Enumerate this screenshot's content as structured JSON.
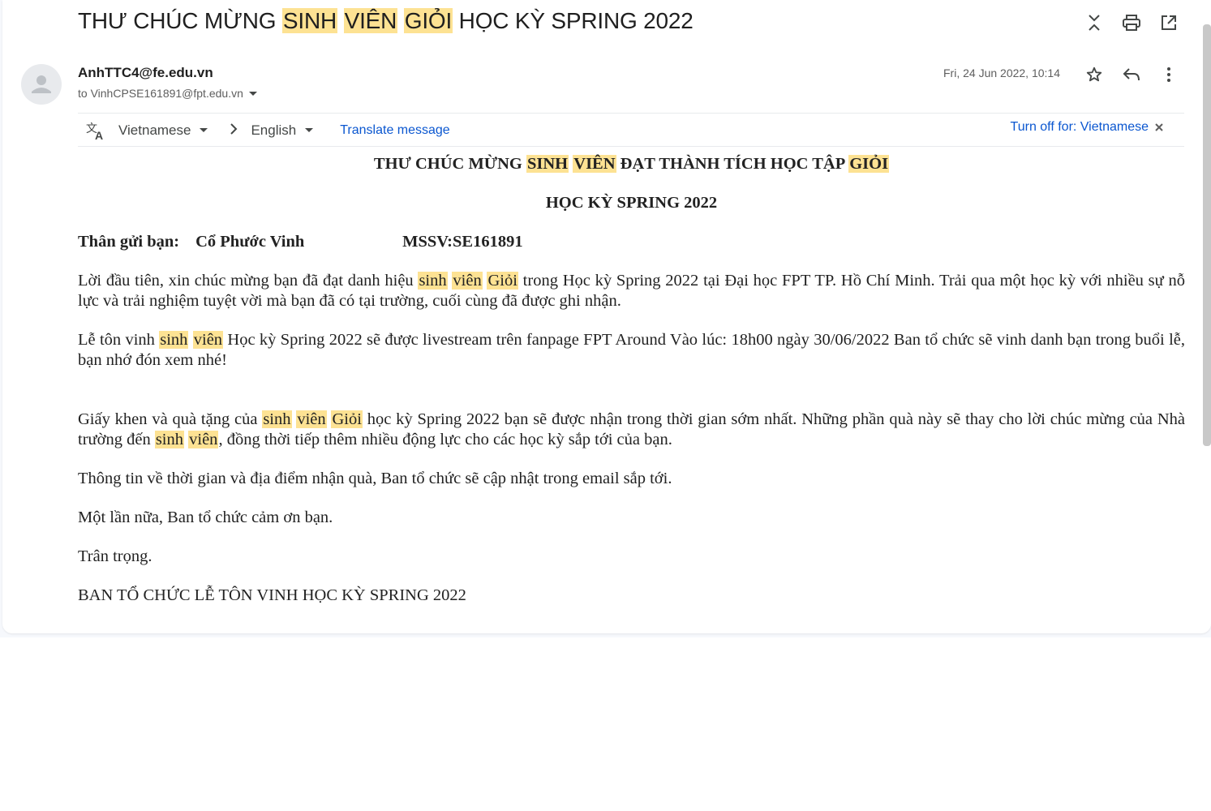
{
  "email": {
    "subject_parts": [
      {
        "text": "THƯ CHÚC MỪNG ",
        "hl": false
      },
      {
        "text": "SINH",
        "hl": true
      },
      {
        "text": " ",
        "hl": false
      },
      {
        "text": "VIÊN",
        "hl": true
      },
      {
        "text": " ",
        "hl": false
      },
      {
        "text": "GIỎI",
        "hl": true
      },
      {
        "text": " HỌC KỲ SPRING 2022",
        "hl": false
      }
    ],
    "sender": "AnhTTC4@fe.edu.vn",
    "recipient": "to VinhCPSE161891@fpt.edu.vn",
    "date": "Fri, 24 Jun 2022, 10:14"
  },
  "translate": {
    "from_lang": "Vietnamese",
    "to_lang": "English",
    "translate_link": "Translate message",
    "turn_off": "Turn off for: Vietnamese"
  },
  "body": {
    "heading1_parts": [
      {
        "text": "THƯ CHÚC MỪNG ",
        "hl": false
      },
      {
        "text": "SINH",
        "hl": true
      },
      {
        "text": " ",
        "hl": false
      },
      {
        "text": "VIÊN",
        "hl": true
      },
      {
        "text": " ĐẠT THÀNH TÍCH HỌC TẬP ",
        "hl": false
      },
      {
        "text": "GIỎI",
        "hl": true
      }
    ],
    "heading2": "HỌC KỲ SPRING 2022",
    "greeting_label": "Thân gửi bạn:",
    "student_name": "Cổ Phước Vinh",
    "student_id": "MSSV:SE161891",
    "p1_parts": [
      {
        "text": "Lời đầu tiên, xin chúc mừng bạn đã đạt danh hiệu ",
        "hl": false
      },
      {
        "text": "sinh",
        "hl": true
      },
      {
        "text": " ",
        "hl": false
      },
      {
        "text": "viên",
        "hl": true
      },
      {
        "text": " ",
        "hl": false
      },
      {
        "text": "Giỏi",
        "hl": true
      },
      {
        "text": " trong Học kỳ Spring 2022 tại Đại học FPT TP. Hồ Chí Minh. Trải qua một học kỳ với nhiều sự nỗ lực và trải nghiệm tuyệt vời mà bạn đã có tại trường, cuối cùng đã được ghi nhận.",
        "hl": false
      }
    ],
    "p2_parts": [
      {
        "text": "Lễ tôn vinh ",
        "hl": false
      },
      {
        "text": "sinh",
        "hl": true
      },
      {
        "text": " ",
        "hl": false
      },
      {
        "text": "viên",
        "hl": true
      },
      {
        "text": " Học kỳ Spring 2022 sẽ được livestream trên fanpage FPT Around Vào lúc: 18h00 ngày 30/06/2022  Ban tổ chức sẽ vinh danh bạn trong buổi lễ, bạn nhớ đón xem nhé!",
        "hl": false
      }
    ],
    "p3_parts": [
      {
        "text": "Giấy khen và quà tặng của ",
        "hl": false
      },
      {
        "text": "sinh",
        "hl": true
      },
      {
        "text": " ",
        "hl": false
      },
      {
        "text": "viên",
        "hl": true
      },
      {
        "text": " ",
        "hl": false
      },
      {
        "text": "Giỏi",
        "hl": true
      },
      {
        "text": " học kỳ Spring 2022 bạn sẽ được nhận trong thời gian sớm nhất. Những phần quà này sẽ thay cho lời chúc mừng của Nhà trường đến ",
        "hl": false
      },
      {
        "text": "sinh",
        "hl": true
      },
      {
        "text": " ",
        "hl": false
      },
      {
        "text": "viên",
        "hl": true
      },
      {
        "text": ", đồng thời tiếp thêm nhiều động lực cho các học kỳ sắp tới của bạn.",
        "hl": false
      }
    ],
    "p4": "Thông tin về thời gian và địa điểm nhận quà, Ban tổ chức sẽ cập nhật trong email sắp tới.",
    "p5": "Một lần nữa, Ban tổ chức cảm ơn bạn.",
    "p6": "Trân trọng.",
    "signature": "BAN TỔ CHỨC LỄ TÔN VINH HỌC KỲ SPRING 2022"
  },
  "icons": {
    "collapse": "collapse-icon",
    "print": "print-icon",
    "open_new_window": "open-in-new-window-icon",
    "star": "star-icon",
    "reply": "reply-icon",
    "more": "more-vert-icon",
    "translate": "translate-icon"
  },
  "colors": {
    "highlight": "#fde293",
    "link": "#0b57d0",
    "text": "#1f1f1f"
  }
}
